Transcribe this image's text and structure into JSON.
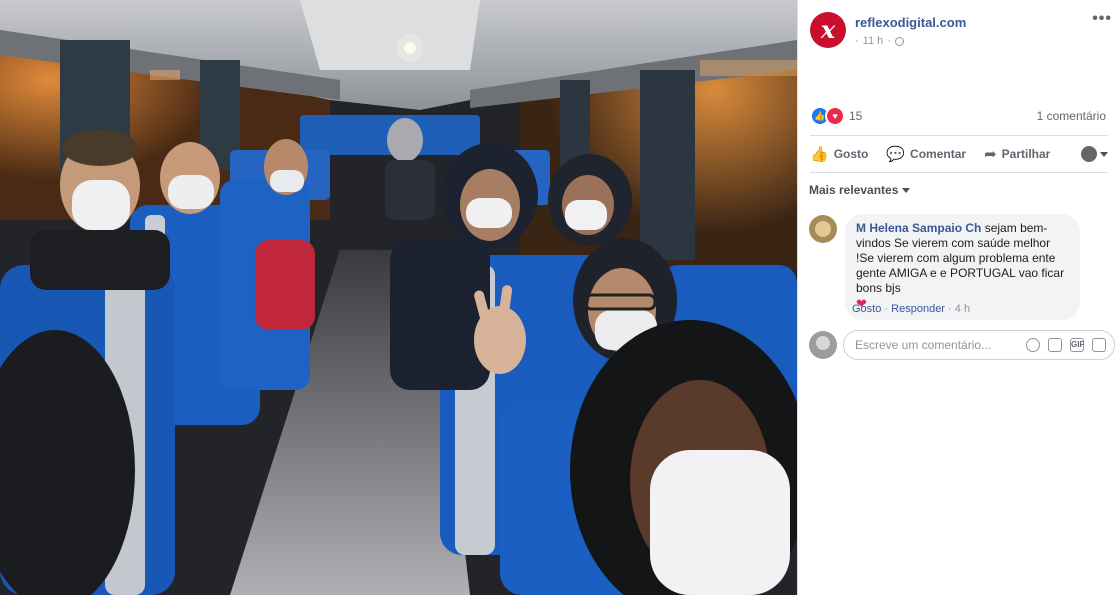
{
  "post": {
    "page_name": "reflexodigital.com",
    "logo_letter": "x",
    "time": "11 h",
    "separator": "·",
    "more_label": "•••"
  },
  "reactions": {
    "count": "15",
    "comments_count": "1 comentário"
  },
  "actions": {
    "like": "Gosto",
    "comment": "Comentar",
    "share": "Partilhar"
  },
  "comments_filter": "Mais relevantes",
  "comment": {
    "author": "M Helena Sampaio Ch",
    "text": "sejam bem-vindos Se vierem com saúde melhor !Se vierem com algum problema ente gente AMIGA e e PORTUGAL vao ficar bons bjs",
    "heart": "❤",
    "like_link": "Gosto",
    "reply_link": "Responder",
    "time": "4 h",
    "dot": "·"
  },
  "composer": {
    "placeholder": "Escreve um comentário...",
    "gif_label": "GIF"
  },
  "colors": {
    "link": "#385898",
    "logo_red": "#c8102e",
    "seat_blue": "#1a5fc0"
  }
}
